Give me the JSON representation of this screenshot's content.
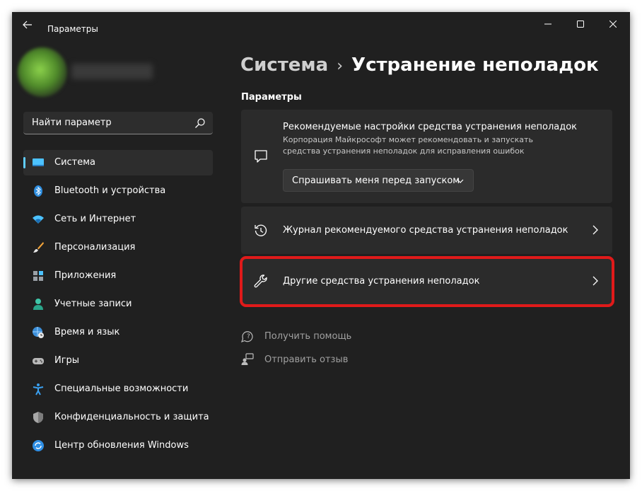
{
  "window": {
    "title": "Параметры"
  },
  "search": {
    "placeholder": "Найти параметр"
  },
  "nav": {
    "items": [
      {
        "label": "Система",
        "icon": "monitor-icon"
      },
      {
        "label": "Bluetooth и устройства",
        "icon": "bluetooth-icon"
      },
      {
        "label": "Сеть и Интернет",
        "icon": "wifi-icon"
      },
      {
        "label": "Персонализация",
        "icon": "brush-icon"
      },
      {
        "label": "Приложения",
        "icon": "apps-icon"
      },
      {
        "label": "Учетные записи",
        "icon": "user-icon"
      },
      {
        "label": "Время и язык",
        "icon": "globe-clock-icon"
      },
      {
        "label": "Игры",
        "icon": "gamepad-icon"
      },
      {
        "label": "Специальные возможности",
        "icon": "accessibility-icon"
      },
      {
        "label": "Конфиденциальность и защита",
        "icon": "shield-icon"
      },
      {
        "label": "Центр обновления Windows",
        "icon": "update-icon"
      }
    ]
  },
  "breadcrumb": {
    "parent": "Система",
    "separator": "›",
    "current": "Устранение неполадок"
  },
  "section": {
    "label": "Параметры"
  },
  "cards": {
    "recommended": {
      "title": "Рекомендуемые настройки средства устранения неполадок",
      "description": "Корпорация Майкрософт может рекомендовать и запускать средства устранения неполадок для исправления ошибок",
      "dropdown_value": "Спрашивать меня перед запуском"
    },
    "history": {
      "title": "Журнал рекомендуемого средства устранения неполадок"
    },
    "other": {
      "title": "Другие средства устранения неполадок"
    }
  },
  "links": {
    "help": "Получить помощь",
    "feedback": "Отправить отзыв"
  },
  "colors": {
    "accent": "#60cdff",
    "highlight": "#e01a1a",
    "background": "#202020",
    "card": "#2b2b2b"
  }
}
